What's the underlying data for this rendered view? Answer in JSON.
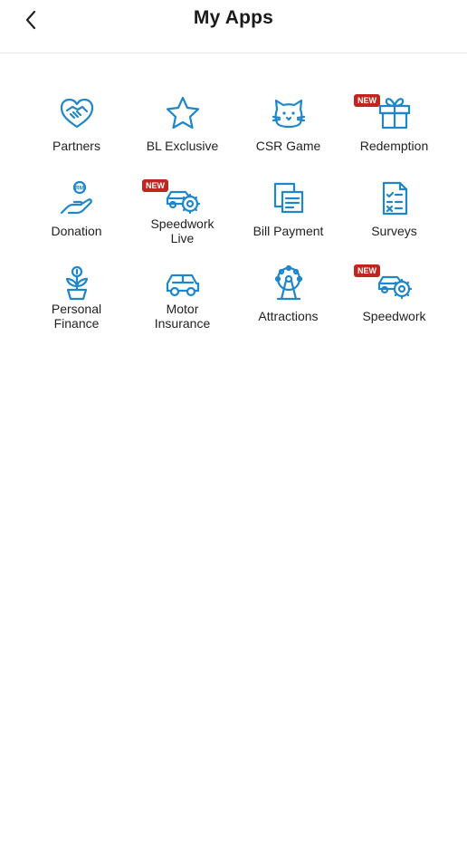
{
  "header": {
    "title": "My Apps",
    "back_icon": "chevron-left-icon"
  },
  "badge_new": "NEW",
  "apps": [
    {
      "label": "Partners",
      "icon": "handshake-heart-icon"
    },
    {
      "label": "BL Exclusive",
      "icon": "star-icon"
    },
    {
      "label": "CSR Game",
      "icon": "cat-face-icon"
    },
    {
      "label": "Redemption",
      "icon": "gift-icon",
      "is_new": true
    },
    {
      "label": "Donation",
      "icon": "hand-coin-icon",
      "coin_text": "RM"
    },
    {
      "label": "Speedwork Live",
      "label_line1": "Speedwork",
      "label_line2": "Live",
      "icon": "car-gear-icon",
      "is_new": true
    },
    {
      "label": "Bill Payment",
      "icon": "bill-icon"
    },
    {
      "label": "Surveys",
      "icon": "survey-clipboard-icon"
    },
    {
      "label": "Personal Finance",
      "label_line1": "Personal",
      "label_line2": "Finance",
      "icon": "money-plant-icon"
    },
    {
      "label": "Motor Insurance",
      "label_line1": "Motor",
      "label_line2": "Insurance",
      "icon": "car-icon"
    },
    {
      "label": "Attractions",
      "icon": "ferris-wheel-icon"
    },
    {
      "label": "Speedwork",
      "icon": "car-gear-icon",
      "is_new": true
    }
  ],
  "colors": {
    "accent": "#1f86c9",
    "badge": "#c0261f"
  }
}
